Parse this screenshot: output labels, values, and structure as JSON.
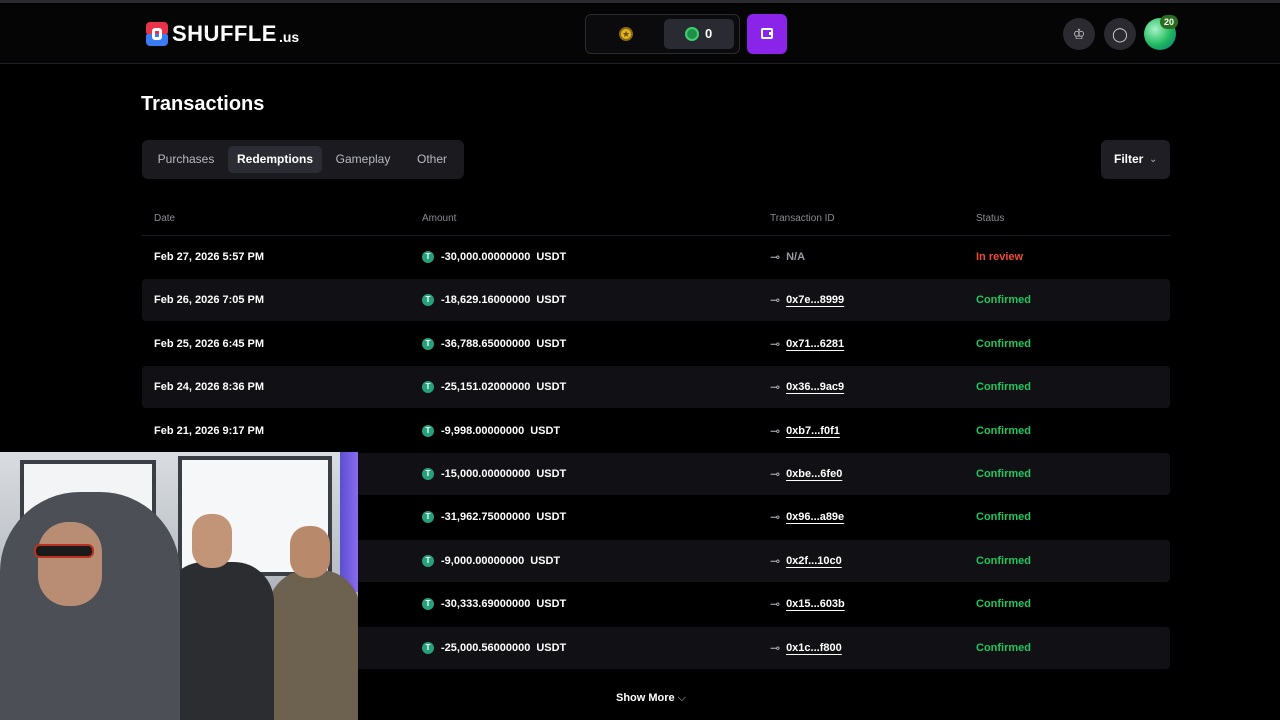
{
  "header": {
    "logo_text": "SHUFFLE",
    "logo_sub": ".us",
    "gold_coin_icon": "gold-coin-icon",
    "sweeps_balance": "0",
    "wallet_icon": "wallet-icon",
    "rewards_icon": "crown-icon",
    "chat_icon": "chat-icon",
    "avatar_badge": "20"
  },
  "page": {
    "title": "Transactions",
    "tabs": [
      {
        "label": "Purchases",
        "active": false
      },
      {
        "label": "Redemptions",
        "active": true
      },
      {
        "label": "Gameplay",
        "active": false
      },
      {
        "label": "Other",
        "active": false
      }
    ],
    "filter_label": "Filter"
  },
  "table": {
    "columns": [
      "Date",
      "Amount",
      "Transaction ID",
      "Status"
    ],
    "rows": [
      {
        "date": "Feb 27, 2026 5:57 PM",
        "amount": "-30,000.00000000",
        "currency": "USDT",
        "tx": "N/A",
        "status": "In review"
      },
      {
        "date": "Feb 26, 2026 7:05 PM",
        "amount": "-18,629.16000000",
        "currency": "USDT",
        "tx": "0x7e...8999",
        "status": "Confirmed"
      },
      {
        "date": "Feb 25, 2026 6:45 PM",
        "amount": "-36,788.65000000",
        "currency": "USDT",
        "tx": "0x71...6281",
        "status": "Confirmed"
      },
      {
        "date": "Feb 24, 2026 8:36 PM",
        "amount": "-25,151.02000000",
        "currency": "USDT",
        "tx": "0x36...9ac9",
        "status": "Confirmed"
      },
      {
        "date": "Feb 21, 2026 9:17 PM",
        "amount": "-9,998.00000000",
        "currency": "USDT",
        "tx": "0xb7...f0f1",
        "status": "Confirmed"
      },
      {
        "date": "",
        "amount": "-15,000.00000000",
        "currency": "USDT",
        "tx": "0xbe...6fe0",
        "status": "Confirmed"
      },
      {
        "date": "",
        "amount": "-31,962.75000000",
        "currency": "USDT",
        "tx": "0x96...a89e",
        "status": "Confirmed"
      },
      {
        "date": "",
        "amount": "-9,000.00000000",
        "currency": "USDT",
        "tx": "0x2f...10c0",
        "status": "Confirmed"
      },
      {
        "date": "",
        "amount": "-30,333.69000000",
        "currency": "USDT",
        "tx": "0x15...603b",
        "status": "Confirmed"
      },
      {
        "date": "",
        "amount": "-25,000.56000000",
        "currency": "USDT",
        "tx": "0x1c...f800",
        "status": "Confirmed"
      }
    ],
    "show_more": "Show More"
  },
  "colors": {
    "accent_purple": "#8a24e8",
    "confirmed": "#22c55e",
    "in_review": "#ef4b3b"
  }
}
